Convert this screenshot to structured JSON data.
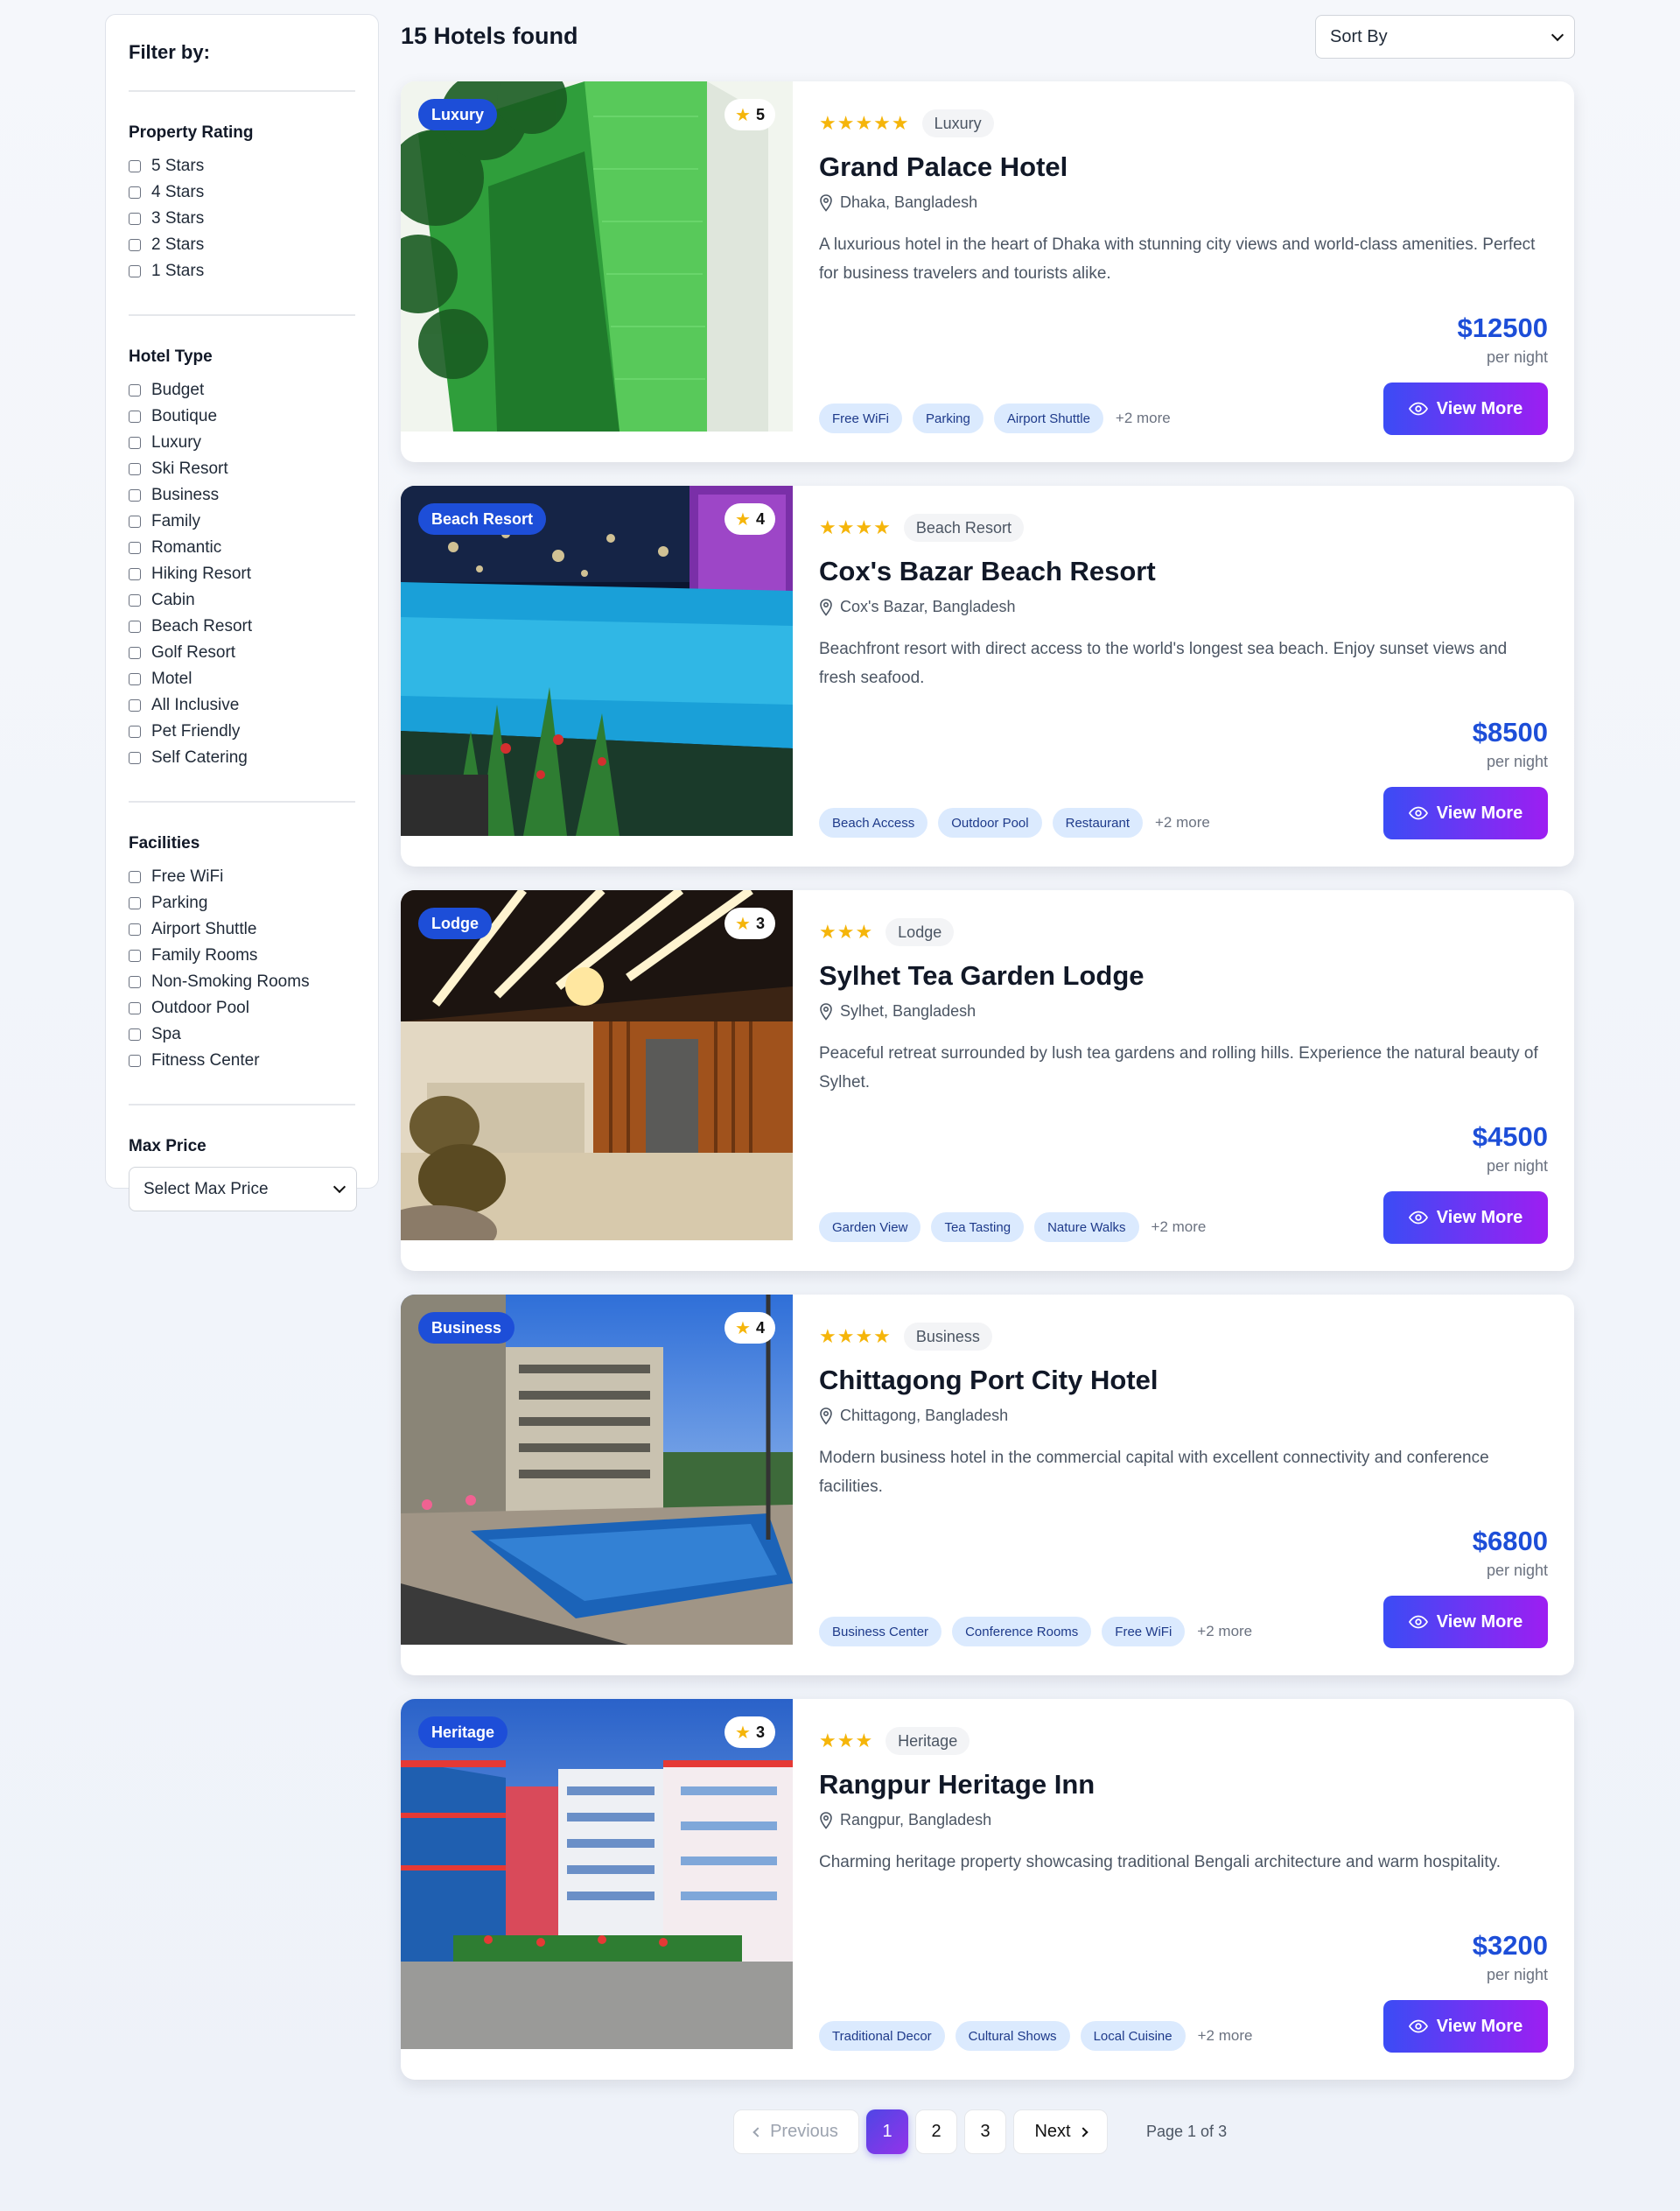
{
  "sidebar": {
    "title": "Filter by:",
    "rating": {
      "heading": "Property Rating",
      "options": [
        "5 Stars",
        "4 Stars",
        "3 Stars",
        "2 Stars",
        "1 Stars"
      ]
    },
    "hotel_type": {
      "heading": "Hotel Type",
      "options": [
        "Budget",
        "Boutique",
        "Luxury",
        "Ski Resort",
        "Business",
        "Family",
        "Romantic",
        "Hiking Resort",
        "Cabin",
        "Beach Resort",
        "Golf Resort",
        "Motel",
        "All Inclusive",
        "Pet Friendly",
        "Self Catering"
      ]
    },
    "facilities": {
      "heading": "Facilities",
      "options": [
        "Free WiFi",
        "Parking",
        "Airport Shuttle",
        "Family Rooms",
        "Non-Smoking Rooms",
        "Outdoor Pool",
        "Spa",
        "Fitness Center"
      ]
    },
    "max_price": {
      "heading": "Max Price",
      "value": "Select Max Price"
    }
  },
  "header": {
    "results": "15 Hotels found",
    "sort": "Sort By"
  },
  "hotels": [
    {
      "badge": "Luxury",
      "rating": "5",
      "stars": "★★★★★",
      "type": "Luxury",
      "name": "Grand Palace Hotel",
      "location": "Dhaka, Bangladesh",
      "description": "A luxurious hotel in the heart of Dhaka with stunning city views and world-class amenities. Perfect for business travelers and tourists alike.",
      "price": "$12500",
      "per_night": "per night",
      "tags": [
        "Free WiFi",
        "Parking",
        "Airport Shuttle"
      ],
      "more": "+2 more",
      "button": "View More"
    },
    {
      "badge": "Beach Resort",
      "rating": "4",
      "stars": "★★★★",
      "type": "Beach Resort",
      "name": "Cox's Bazar Beach Resort",
      "location": "Cox's Bazar, Bangladesh",
      "description": "Beachfront resort with direct access to the world's longest sea beach. Enjoy sunset views and fresh seafood.",
      "price": "$8500",
      "per_night": "per night",
      "tags": [
        "Beach Access",
        "Outdoor Pool",
        "Restaurant"
      ],
      "more": "+2 more",
      "button": "View More"
    },
    {
      "badge": "Lodge",
      "rating": "3",
      "stars": "★★★",
      "type": "Lodge",
      "name": "Sylhet Tea Garden Lodge",
      "location": "Sylhet, Bangladesh",
      "description": "Peaceful retreat surrounded by lush tea gardens and rolling hills. Experience the natural beauty of Sylhet.",
      "price": "$4500",
      "per_night": "per night",
      "tags": [
        "Garden View",
        "Tea Tasting",
        "Nature Walks"
      ],
      "more": "+2 more",
      "button": "View More"
    },
    {
      "badge": "Business",
      "rating": "4",
      "stars": "★★★★",
      "type": "Business",
      "name": "Chittagong Port City Hotel",
      "location": "Chittagong, Bangladesh",
      "description": "Modern business hotel in the commercial capital with excellent connectivity and conference facilities.",
      "price": "$6800",
      "per_night": "per night",
      "tags": [
        "Business Center",
        "Conference Rooms",
        "Free WiFi"
      ],
      "more": "+2 more",
      "button": "View More"
    },
    {
      "badge": "Heritage",
      "rating": "3",
      "stars": "★★★",
      "type": "Heritage",
      "name": "Rangpur Heritage Inn",
      "location": "Rangpur, Bangladesh",
      "description": "Charming heritage property showcasing traditional Bengali architecture and warm hospitality.",
      "price": "$3200",
      "per_night": "per night",
      "tags": [
        "Traditional Decor",
        "Cultural Shows",
        "Local Cuisine"
      ],
      "more": "+2 more",
      "button": "View More"
    }
  ],
  "pagination": {
    "previous": "Previous",
    "pages": [
      "1",
      "2",
      "3"
    ],
    "next": "Next",
    "info": "Page 1 of 3"
  },
  "colors": {
    "accent": "#1d4ed8",
    "star": "#f5b50a",
    "button_from": "#3b4cf5",
    "button_to": "#9d1ef2"
  }
}
